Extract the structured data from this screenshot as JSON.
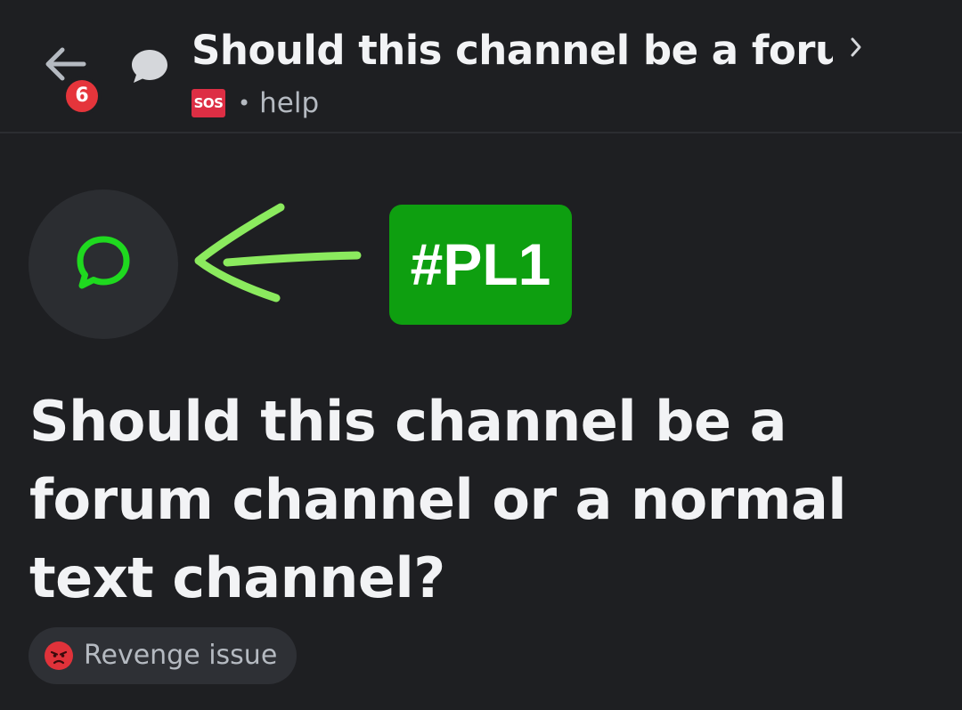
{
  "header": {
    "back_icon": "arrow-left-icon",
    "badge_count": "6",
    "thread_icon": "speech-bubble-icon",
    "title": "Should this channel be a foru...",
    "chevron_icon": "chevron-right-icon",
    "sos_label": "SOS",
    "separator": "•",
    "channel_name": "help"
  },
  "post": {
    "icon": "chat-bubble-icon",
    "annotation_arrow": "hand-drawn-arrow-icon",
    "annotation_label": "#PL1",
    "title": "Should this channel be a forum channel or a normal text channel?",
    "tag": {
      "emoji": "angry-face-icon",
      "label": "Revenge issue"
    }
  },
  "colors": {
    "background": "#1e1f22",
    "badge": "#e5353b",
    "sos": "#dd2e44",
    "annotation_green": "#0e9f10",
    "icon_green": "#1fd91f",
    "arrow_green": "#8bea5e",
    "tag_pill": "#2e3035"
  }
}
